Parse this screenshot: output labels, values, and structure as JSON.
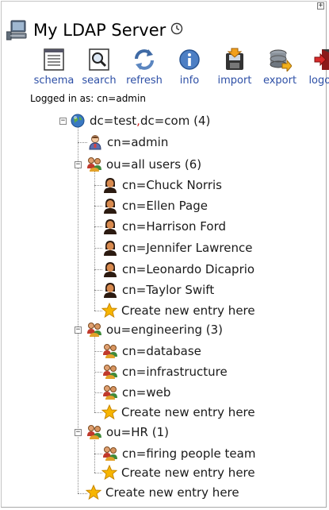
{
  "window": {
    "expand_symbol": "+"
  },
  "server": {
    "name": "My LDAP Server"
  },
  "toolbar": [
    {
      "label": "schema",
      "icon": "schema-icon"
    },
    {
      "label": "search",
      "icon": "search-icon"
    },
    {
      "label": "refresh",
      "icon": "refresh-icon"
    },
    {
      "label": "info",
      "icon": "info-icon"
    },
    {
      "label": "import",
      "icon": "import-icon"
    },
    {
      "label": "export",
      "icon": "export-icon"
    },
    {
      "label": "logout",
      "icon": "logout-icon"
    }
  ],
  "login": {
    "text": "Logged in as: cn=admin"
  },
  "tree": {
    "toggle_symbol": "−",
    "root": {
      "part1": "dc=test",
      "sep": ",",
      "part2": "dc=com",
      "count": "(4)"
    },
    "admin": "cn=admin",
    "all_users": {
      "label": "ou=all users (6)",
      "entries": [
        "cn=Chuck Norris",
        "cn=Ellen Page",
        "cn=Harrison Ford",
        "cn=Jennifer Lawrence",
        "cn=Leonardo Dicaprio",
        "cn=Taylor Swift"
      ],
      "create": "Create new entry here"
    },
    "engineering": {
      "label": "ou=engineering (3)",
      "entries": [
        "cn=database",
        "cn=infrastructure",
        "cn=web"
      ],
      "create": "Create new entry here"
    },
    "hr": {
      "label": "ou=HR (1)",
      "entries": [
        "cn=firing people team"
      ],
      "create": "Create new entry here"
    },
    "root_create": "Create new entry here"
  },
  "colors": {
    "link": "#2d4fa6",
    "separator": "#d02020",
    "border": "#c4c4c4",
    "star": "#f7b500"
  }
}
